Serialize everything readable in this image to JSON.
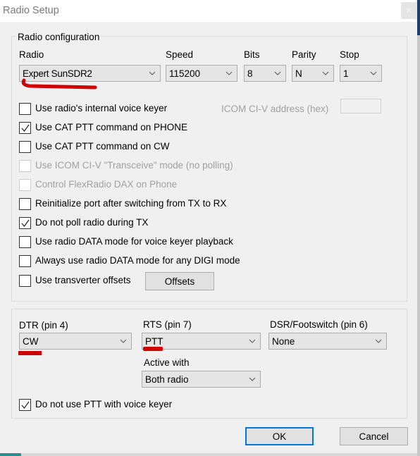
{
  "window": {
    "title": "Radio Setup",
    "close_glyph": "×"
  },
  "radio_config": {
    "legend": "Radio configuration",
    "labels": {
      "radio": "Radio",
      "speed": "Speed",
      "bits": "Bits",
      "parity": "Parity",
      "stop": "Stop"
    },
    "values": {
      "radio": "Expert SunSDR2",
      "speed": "115200",
      "bits": "8",
      "parity": "N",
      "stop": "1"
    },
    "icom_address": {
      "label": "ICOM CI-V address (hex)",
      "value": ""
    },
    "checkboxes": [
      {
        "label": "Use radio's internal voice keyer",
        "checked": false,
        "enabled": true
      },
      {
        "label": "Use CAT PTT command on PHONE",
        "checked": true,
        "enabled": true
      },
      {
        "label": "Use CAT PTT command on CW",
        "checked": false,
        "enabled": true
      },
      {
        "label": "Use ICOM CI-V \"Transceive\" mode (no polling)",
        "checked": false,
        "enabled": false
      },
      {
        "label": "Control FlexRadio DAX on Phone",
        "checked": false,
        "enabled": false
      },
      {
        "label": "Reinitialize port after switching from TX to RX",
        "checked": false,
        "enabled": true
      },
      {
        "label": "Do not poll radio during TX",
        "checked": true,
        "enabled": true
      },
      {
        "label": "Use radio DATA mode for voice keyer playback",
        "checked": false,
        "enabled": true
      },
      {
        "label": "Always use radio DATA mode for any DIGI mode",
        "checked": false,
        "enabled": true
      },
      {
        "label": "Use transverter offsets",
        "checked": false,
        "enabled": true
      }
    ],
    "offsets_button": "Offsets"
  },
  "pins": {
    "dtr": {
      "label": "DTR (pin 4)",
      "value": "CW"
    },
    "rts": {
      "label": "RTS (pin 7)",
      "value": "PTT"
    },
    "dsr": {
      "label": "DSR/Footswitch (pin 6)",
      "value": "None"
    },
    "active_with": {
      "label": "Active with",
      "value": "Both radio"
    },
    "no_ptt_voice": {
      "label": "Do not use PTT with voice keyer",
      "checked": true
    }
  },
  "buttons": {
    "ok": "OK",
    "cancel": "Cancel"
  },
  "annotation_color": "#d00000"
}
